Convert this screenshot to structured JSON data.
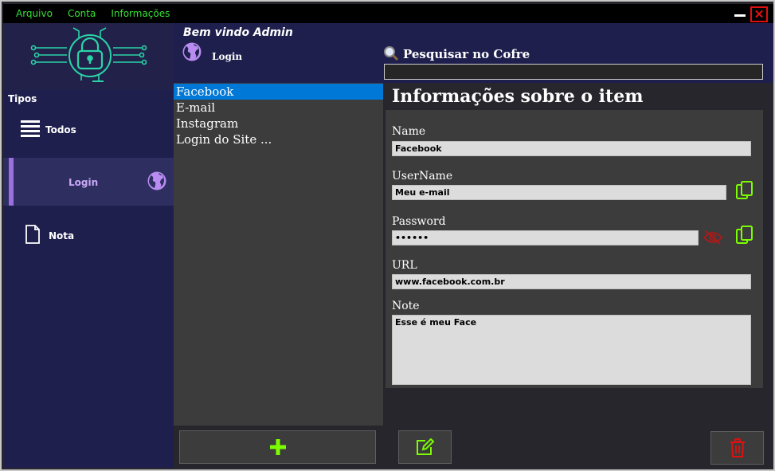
{
  "menu": {
    "items": [
      "Arquivo",
      "Conta",
      "Informações"
    ]
  },
  "window_controls": {
    "close_glyph": "✕"
  },
  "sidebar": {
    "section_title": "Tipos",
    "items": [
      {
        "label": "Todos",
        "icon": "hamburger-menu-icon"
      },
      {
        "label": "Login",
        "icon": "globe-icon",
        "active": true
      },
      {
        "label": "Nota",
        "icon": "document-icon"
      }
    ]
  },
  "header": {
    "welcome": "Bem vindo Admin",
    "category_title": "Login",
    "search_label": "Pesquisar no Cofre",
    "search_value": ""
  },
  "items_list": {
    "items": [
      "Facebook",
      "E-mail",
      "Instagram",
      "Login do Site ..."
    ],
    "selected_index": 0
  },
  "details": {
    "title": "Informações sobre o item",
    "fields": {
      "name": {
        "label": "Name",
        "value": "Facebook"
      },
      "username": {
        "label": "UserName",
        "value": "Meu e-mail"
      },
      "password": {
        "label": "Password",
        "value": "••••••"
      },
      "url": {
        "label": "URL",
        "value": "www.facebook.com.br"
      },
      "note": {
        "label": "Note",
        "value": "Esse é meu Face"
      }
    }
  },
  "colors": {
    "menu_text": "#36e036",
    "sidebar_bg": "#1f1f4e",
    "accent_purple": "#9b6fe0",
    "selected_blue": "#0078d7",
    "add_green": "#7cfc00",
    "delete_red": "#e01010",
    "logo_teal": "#2ad4a8"
  }
}
